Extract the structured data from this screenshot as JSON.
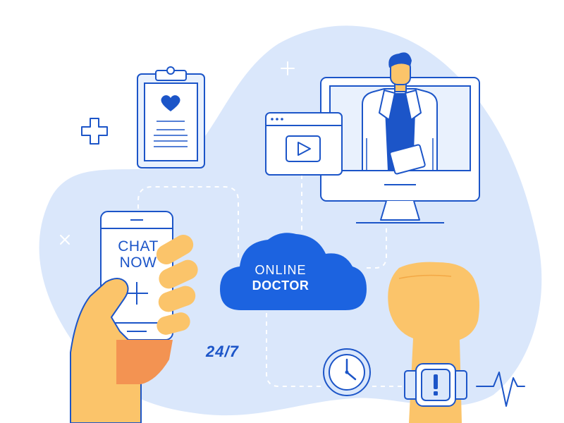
{
  "phone": {
    "line1": "CHAT",
    "line2": "NOW"
  },
  "cloud": {
    "line1": "ONLINE",
    "line2": "DOCTOR"
  },
  "availability": "24/7",
  "colors": {
    "blob": "#dae7fb",
    "blue": "#1c55c8",
    "cloud": "#1c63e0",
    "skin": "#fbc46a",
    "sleeve": "#f39352",
    "screen_bg": "#e9f1fd"
  },
  "icons": [
    "clipboard-icon",
    "heart-icon",
    "medical-cross-icon",
    "video-window-icon",
    "play-icon",
    "monitor-icon",
    "doctor-figure",
    "smartphone-icon",
    "cloud-icon",
    "clock-icon",
    "smartwatch-icon",
    "alert-icon",
    "heartbeat-pulse-icon",
    "sparkle-plus-icon",
    "sparkle-x-icon"
  ]
}
